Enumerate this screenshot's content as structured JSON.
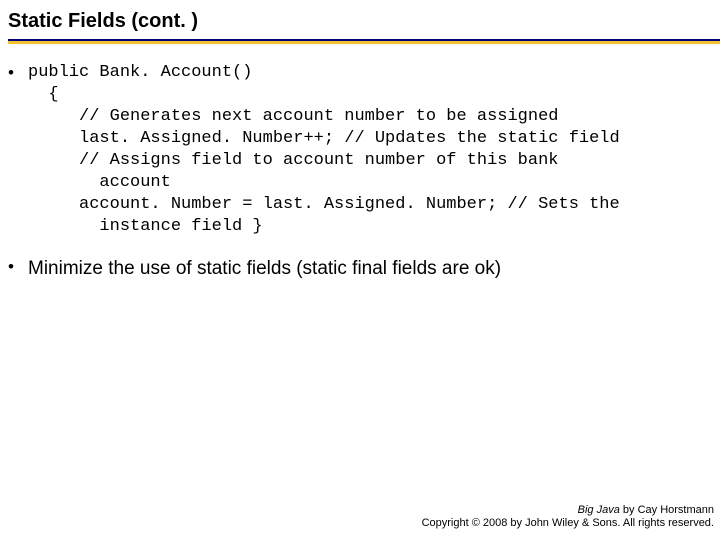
{
  "title": "Static Fields  (cont. )",
  "code": {
    "l1": "public Bank. Account()",
    "l2": "  {",
    "l3": "     // Generates next account number to be assigned",
    "l4": "     last. Assigned. Number++; // Updates the static field",
    "l5": "     // Assigns field to account number of this bank",
    "l6": "       account",
    "l7": "     account. Number = last. Assigned. Number; // Sets the",
    "l8": "       instance field }"
  },
  "bullet2": "Minimize the use of static fields (static final fields are ok)",
  "footer": {
    "line1_book": "Big Java",
    "line1_rest": " by Cay Horstmann",
    "line2": "Copyright © 2008 by John Wiley & Sons. All rights reserved."
  }
}
